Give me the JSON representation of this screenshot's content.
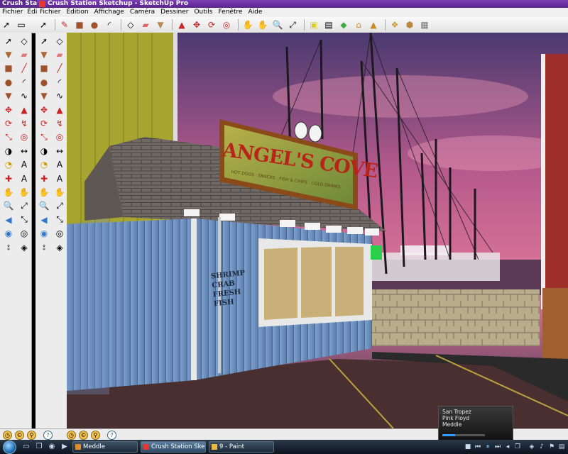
{
  "back_window": {
    "title": "Crush Static",
    "menu": [
      "Fichier",
      "Éditio"
    ]
  },
  "window": {
    "title": "Crush Station Sketchup - SketchUp Pro"
  },
  "menu": {
    "items": [
      "Fichier",
      "Édition",
      "Affichage",
      "Caméra",
      "Dessiner",
      "Outils",
      "Fenêtre",
      "Aide"
    ]
  },
  "scene": {
    "sign_text": "ANGEL'S COVE",
    "sign_subtitle": "HOT DOGS · SNACKS · FISH & CHIPS · COLD DRINKS",
    "wall_text_1": "SHRIMP",
    "wall_text_2": "CRAB",
    "wall_text_3": "FRESH",
    "wall_text_4": "FISH",
    "sky_color": "#c8648c",
    "wall_color": "#6f8fbf",
    "roof_color": "#6b6460",
    "ground_color": "#4a2f30"
  },
  "media_player": {
    "track": "San Tropez",
    "artist": "Pink Floyd",
    "album": "Meddle",
    "progress": 0.3
  },
  "taskbar": {
    "tasks": [
      {
        "label": "Meddle"
      },
      {
        "label": "Crush Station Sketc..."
      },
      {
        "label": "9 - Paint"
      }
    ]
  }
}
